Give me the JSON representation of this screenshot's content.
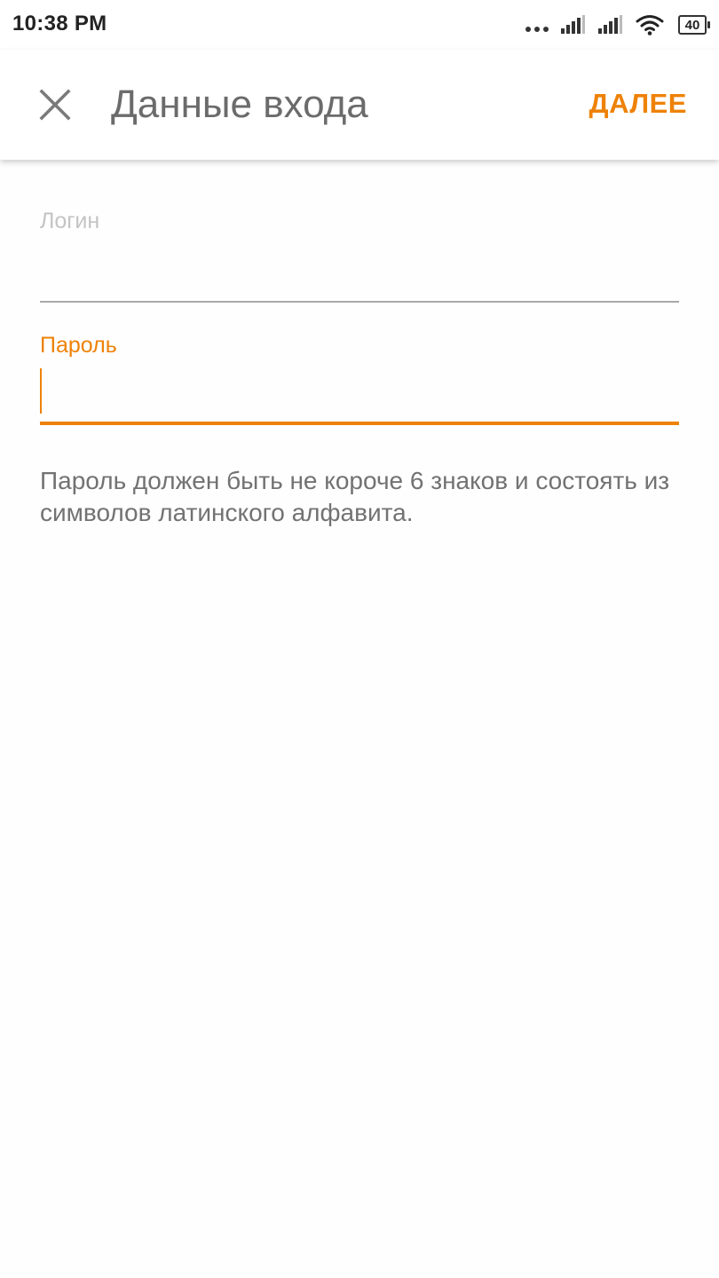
{
  "status_bar": {
    "time": "10:38 PM",
    "battery": "40",
    "icons": [
      "more-dots-icon",
      "signal-icon",
      "signal-icon",
      "wifi-icon",
      "battery-icon"
    ]
  },
  "app_bar": {
    "close_icon": "close-icon",
    "title": "Данные входа",
    "next_label": "ДАЛЕЕ"
  },
  "form": {
    "login": {
      "label": "Логин",
      "value": ""
    },
    "password": {
      "label": "Пароль",
      "value": ""
    },
    "hint": "Пароль должен быть не короче 6 знаков и состоять из символов латинского алфавита."
  },
  "colors": {
    "accent": "#ee8208",
    "title": "#6b6b6b",
    "hint": "#727272",
    "inactive_label": "#c4c4c4"
  }
}
